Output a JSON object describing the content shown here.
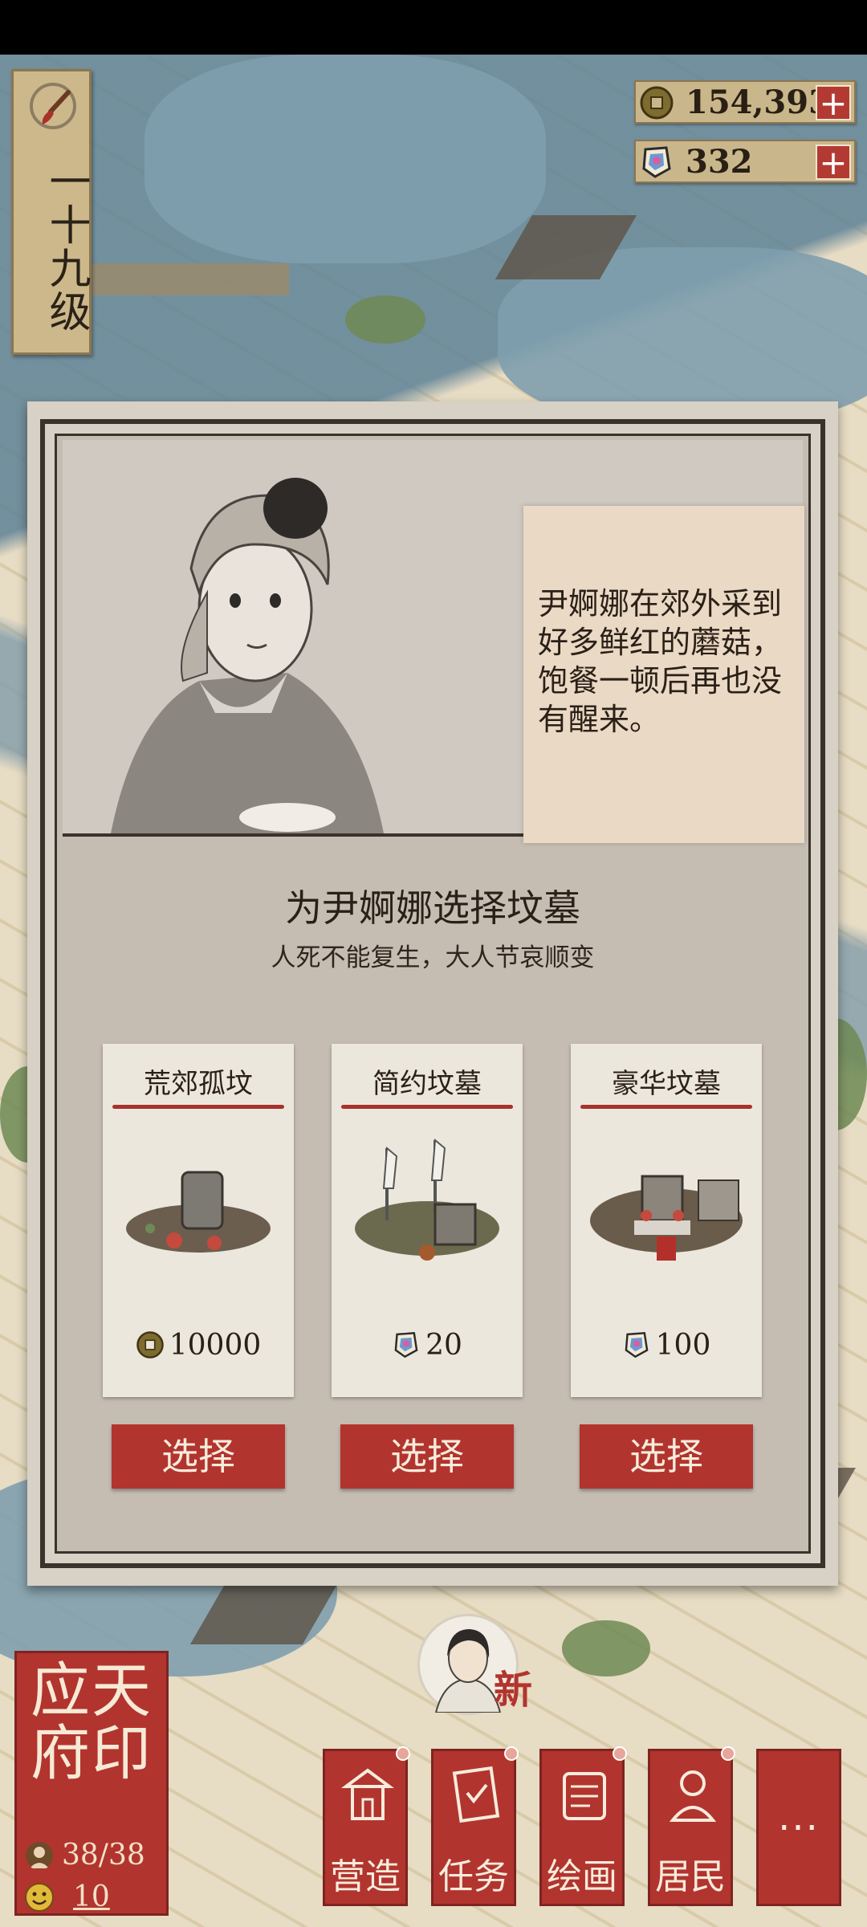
{
  "level": {
    "label": "一十九级"
  },
  "currencies": [
    {
      "icon": "copper-coin-icon",
      "value": "154,393",
      "plus": "+"
    },
    {
      "icon": "jade-ticket-icon",
      "value": "332",
      "plus": "+"
    }
  ],
  "dialog": {
    "speech": "尹婀娜在郊外采到好多鲜红的蘑菇，饱餐一顿后再也没有醒来。",
    "title": "为尹婀娜选择坟墓",
    "subtitle": "人死不能复生，大人节哀顺变",
    "options": [
      {
        "name": "荒郊孤坟",
        "price": "10000",
        "currency_icon": "copper-coin-icon",
        "button": "选择"
      },
      {
        "name": "简约坟墓",
        "price": "20",
        "currency_icon": "jade-ticket-icon",
        "button": "选择"
      },
      {
        "name": "豪华坟墓",
        "price": "100",
        "currency_icon": "jade-ticket-icon",
        "button": "选择"
      }
    ]
  },
  "city": {
    "seal_text": "应天府印",
    "population": "38/38",
    "happiness": "10"
  },
  "avatar": {
    "badge": "新"
  },
  "menu": [
    {
      "label": "营造",
      "icon": "build-icon"
    },
    {
      "label": "任务",
      "icon": "task-icon"
    },
    {
      "label": "绘画",
      "icon": "painting-icon"
    },
    {
      "label": "居民",
      "icon": "resident-icon"
    },
    {
      "label": "···",
      "icon": "more-icon"
    }
  ],
  "colors": {
    "accent_red": "#b2342e",
    "paper": "#ece7dd",
    "ink": "#2a2018"
  }
}
